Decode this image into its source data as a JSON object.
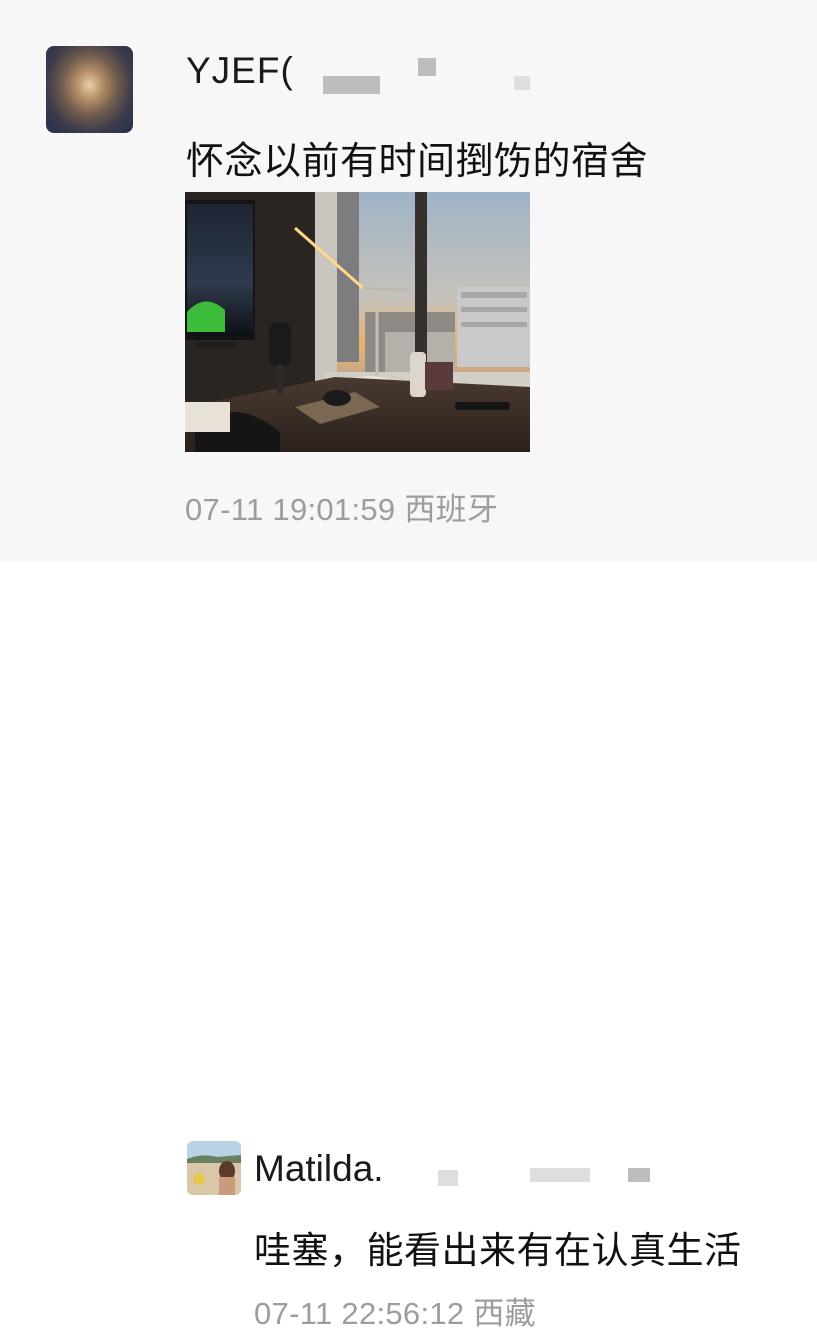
{
  "post": {
    "username": "YJEF(",
    "text": "怀念以前有时间捯饬的宿舍",
    "timestamp": "07-11 19:01:59 西班牙"
  },
  "reply": {
    "username": "Matilda.",
    "text": "哇塞，能看出来有在认真生活",
    "timestamp": "07-11 22:56:12 西藏"
  },
  "colors": {
    "post_background": "#f7f7f7",
    "reply_background": "#ffffff",
    "timestamp": "#9d9d9d"
  }
}
